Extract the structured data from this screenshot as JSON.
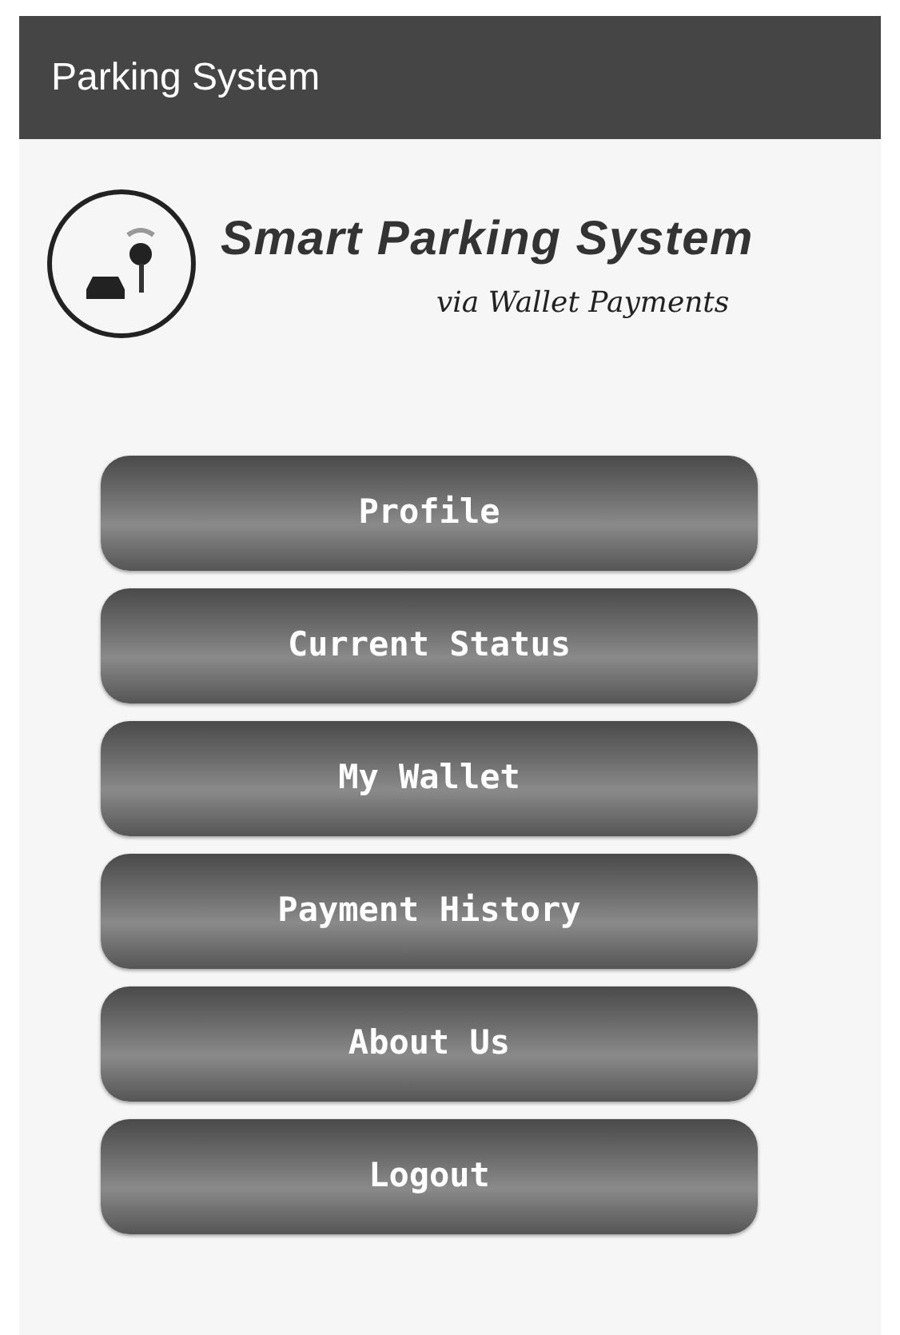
{
  "app_bar": {
    "title": "Parking System"
  },
  "logo": {
    "title": "Smart Parking System",
    "subtitle": "via Wallet Payments"
  },
  "menu": [
    {
      "label": "Profile"
    },
    {
      "label": "Current Status"
    },
    {
      "label": "My Wallet"
    },
    {
      "label": "Payment History"
    },
    {
      "label": "About Us"
    },
    {
      "label": "Logout"
    }
  ]
}
